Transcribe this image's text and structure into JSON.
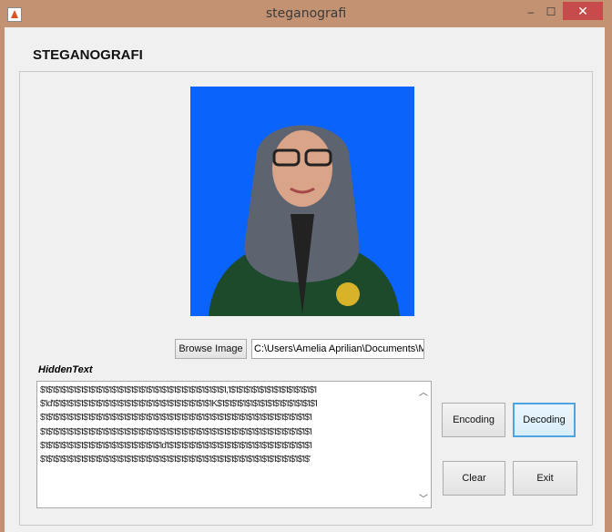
{
  "window": {
    "title": "steganografi",
    "close_glyph": "✕",
    "min_glyph": "‒",
    "max_glyph": "☐"
  },
  "app": {
    "heading": "STEGANOGRAFI"
  },
  "browse_label": "Browse Image",
  "path_value": "C:\\Users\\Amelia Aprilian\\Documents\\MAT",
  "hidden_label": "HiddenText",
  "hidden_text": "$'I$'I$'I$'I$'I$'I$'I$'I$'I$'I$'I$'I$'I$'I$'I$'I$'I$'I$'I$'I$'I$'I$'I$'I$'I$'I,'I$'I$'I$'I$'I$'I$'I$'I$'I$'I$'I$'I$'I\n$'Id'I$'I$'I$'I$'I$'I$'I$'I$'I$'I$'I$'I$'I$'I$'I$'I$'I$'I$'I$'I$'I$'I$'IK$'I$'I$'I$'I$'I$'I$'I$'I$'I$'I$'I$'I$'I$'I\n$'I$'I$'I$'I$'I$'I$'I$'I$'I$'I$'I$'I$'I$'I$'I$'I$'I$'I$'I$'I$'I$'I$'I$'I$'I$'I$'I$'I$'I$'I$'I$'I$'I$'I$'I$'I$'I$'I\n$'I$'I$'I$'I$'I$'I$'I$'I$'I$'I$'I$'I$'I$'I$'I$'I$'I$'I$'I$'I$'I$'I$'I$'I$'I$'I$'I$'I$'I$'I$'I$'I$'I$'I$'I$'I$'I$'I\n$'I$'I$'I$'I$'I$'I$'I$'I$'I$'I$'I$'I$'I$'I$'I$'I$'Id'I$'I$'I$'I$'I$'I$'I$'I$'I$'I$'I$'I$'I$'I$'I$'I$'I$'I$'I$'I$'I\n$'I$'I$'I$'I$'I$'I$'I$'I$'I$'I$'I$'I$'I$'I$'I$'I$'I$'I$'I$'I$'I$'I$'I$'I$'I$'I$'I$'I$'I$'I$'I$'I$'I$'I$'I$'I$'I$'",
  "buttons": {
    "encoding": "Encoding",
    "decoding": "Decoding",
    "clear": "Clear",
    "exit": "Exit"
  },
  "colors": {
    "photo_bg": "#0a63fb",
    "titlebar": "#c29272",
    "close": "#c74b4b"
  }
}
